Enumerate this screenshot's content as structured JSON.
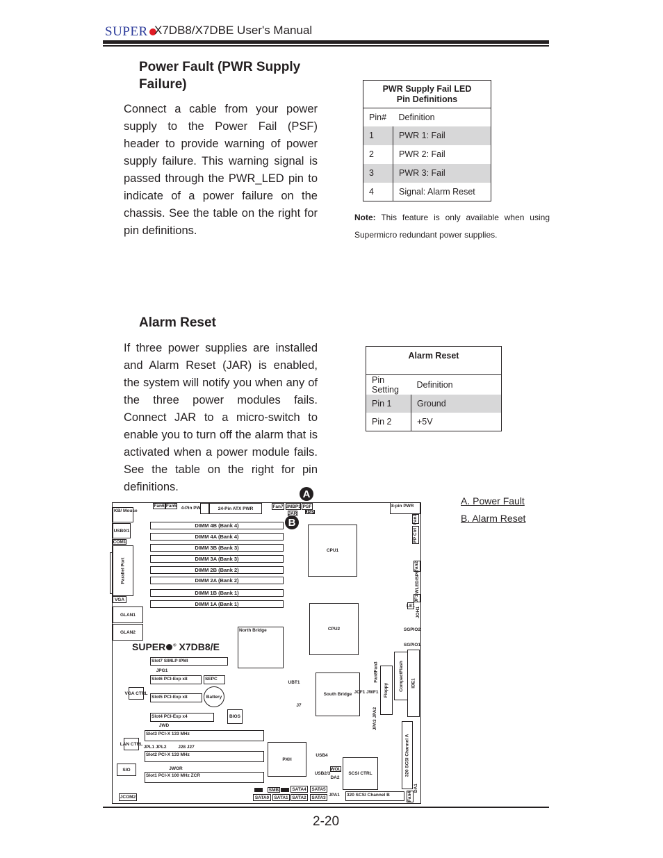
{
  "header": {
    "logo": "SUPER",
    "title": "X7DB8/X7DBE User's Manual"
  },
  "power_fault": {
    "heading": "Power Fault (PWR Supply Failure)",
    "body": "Connect a cable from your power supply to the Power Fail (PSF) header to provide warning of power supply failure.  This warning signal is passed through the PWR_LED pin to indicate of a power failure on the chassis. See the table on the right for pin definitions.",
    "table": {
      "title_line1": "PWR Supply Fail LED",
      "title_line2": "Pin Definitions",
      "col1": "Pin#",
      "col2": "Definition",
      "rows": [
        {
          "pin": "1",
          "def": "PWR 1: Fail"
        },
        {
          "pin": "2",
          "def": "PWR 2: Fail"
        },
        {
          "pin": "3",
          "def": "PWR 3: Fail"
        },
        {
          "pin": "4",
          "def": "Signal: Alarm Reset"
        }
      ]
    },
    "note_label": "Note:",
    "note_text": " This feature is only available when using Supermicro redundant  power supplies."
  },
  "alarm_reset": {
    "heading": "Alarm Reset",
    "body": "If three power supplies are installed and Alarm Reset (JAR) is enabled, the system will notify you when any of the three power modules fails.  Connect JAR to a micro-switch to enable you to turn off the alarm that is activated when a power module fails. See the table on the right for pin definitions.",
    "table": {
      "title": "Alarm Reset",
      "col1": "Pin Setting",
      "col2": "Definition",
      "rows": [
        {
          "pin": "Pin 1",
          "def": "Ground"
        },
        {
          "pin": "Pin 2",
          "def": "+5V"
        }
      ]
    }
  },
  "legend": {
    "a": "A. Power Fault",
    "b": "B. Alarm Reset"
  },
  "diagram": {
    "marker_a": "A",
    "marker_b": "B",
    "board_logo": "SUPER",
    "board_model": "X7DB8/E",
    "board_reg": "®",
    "components": {
      "kb": "KB/ Mouse",
      "usb01": "USB0/1",
      "com1": "COM1",
      "parallel": "Parallel Port",
      "vga": "VGA",
      "glan1": "GLAN1",
      "glan2": "GLAN2",
      "fan6": "Fan6",
      "fan5": "Fan5",
      "pwr4_label": "4-Pin PWR",
      "pwr4": "",
      "atx": "24-Pin ATX PWR",
      "fan7": "Fan7",
      "smbps": "SMBPS",
      "psf": "PSF",
      "jsp": "JSP",
      "jar": "JAR",
      "pwr8": "8-pin PWR",
      "dimm4b": "DIMM 4B (Bank 4)",
      "dimm4a": "DIMM 4A (Bank 4)",
      "dimm3b": "DIMM 3B (Bank 3)",
      "dimm3a": "DIMM 3A (Bank 3)",
      "dimm2b": "DIMM 2B (Bank 2)",
      "dimm2a": "DIMM 2A (Bank 2)",
      "dimm1b": "DIMM 1B (Bank 1)",
      "dimm1a": "DIMM 1A (Bank 1)",
      "cpu1": "CPU1",
      "cpu2": "CPU2",
      "fan1": "Fan1",
      "fpctrl": "FP Ctrl",
      "fan2": "Fan2",
      "pwled": "PWLED/SPK",
      "jf1": "JF1",
      "le1": "LE1",
      "joh1": "JOH1",
      "sgpio2": "SGPIO2",
      "sgpio1": "SGPIO1",
      "northbridge": "North Bridge",
      "slot7": "Slot7   SIMLP IPMI",
      "jpg1": "JPG1",
      "slot6": "Slot6   PCI-Exp x8",
      "sepc": "SEPC",
      "vgactrl": "VGA CTRL",
      "slot5": "Slot5   PCI-Exp x8",
      "battery": "Battery",
      "bios": "BIOS",
      "slot4": "Slot4   PCI-Exp x4",
      "jwd": "JWD",
      "slot3": "Slot3   PCI-X 133 MHz",
      "lanctrl": "LAN CTRL",
      "jpl": "JPL1 JPL2",
      "j2827": "J28 J27",
      "slot2": "Slot2   PCI-X 133 MHz",
      "sio": "SIO",
      "jwor": "JWOR",
      "slot1": "Slot1   PCI-X 100 MHz ZCR",
      "jcom2": "JCOM2",
      "pxh": "PXH",
      "ubt1": "UBT1",
      "j7": "J7",
      "southbridge": "South Bridge",
      "fan8fan3": "Fan8Fan3",
      "jcf": "JCF1 JWF1",
      "floppy": "Floppy",
      "cf": "CompactFlash",
      "ide1": "IDE1",
      "jpa": "JPA3 JPA2",
      "scsia": "320 SCSI Channel A",
      "usb4": "USB4",
      "wol": "WOL",
      "usb23": "USB2/3",
      "da2": "DA2",
      "scsictrl": "SCSI CTRL",
      "scsib": "320 SCSI Channel B",
      "fan4": "Fan4",
      "da1": "DA1",
      "smb": "SMB",
      "sata4": "SATA4",
      "sata5": "SATA5",
      "sata0": "SATA0",
      "sata1": "SATA1",
      "sata2": "SATA2",
      "sata3": "SATA3",
      "jpa1": "JPA1"
    }
  },
  "page_number": "2-20"
}
